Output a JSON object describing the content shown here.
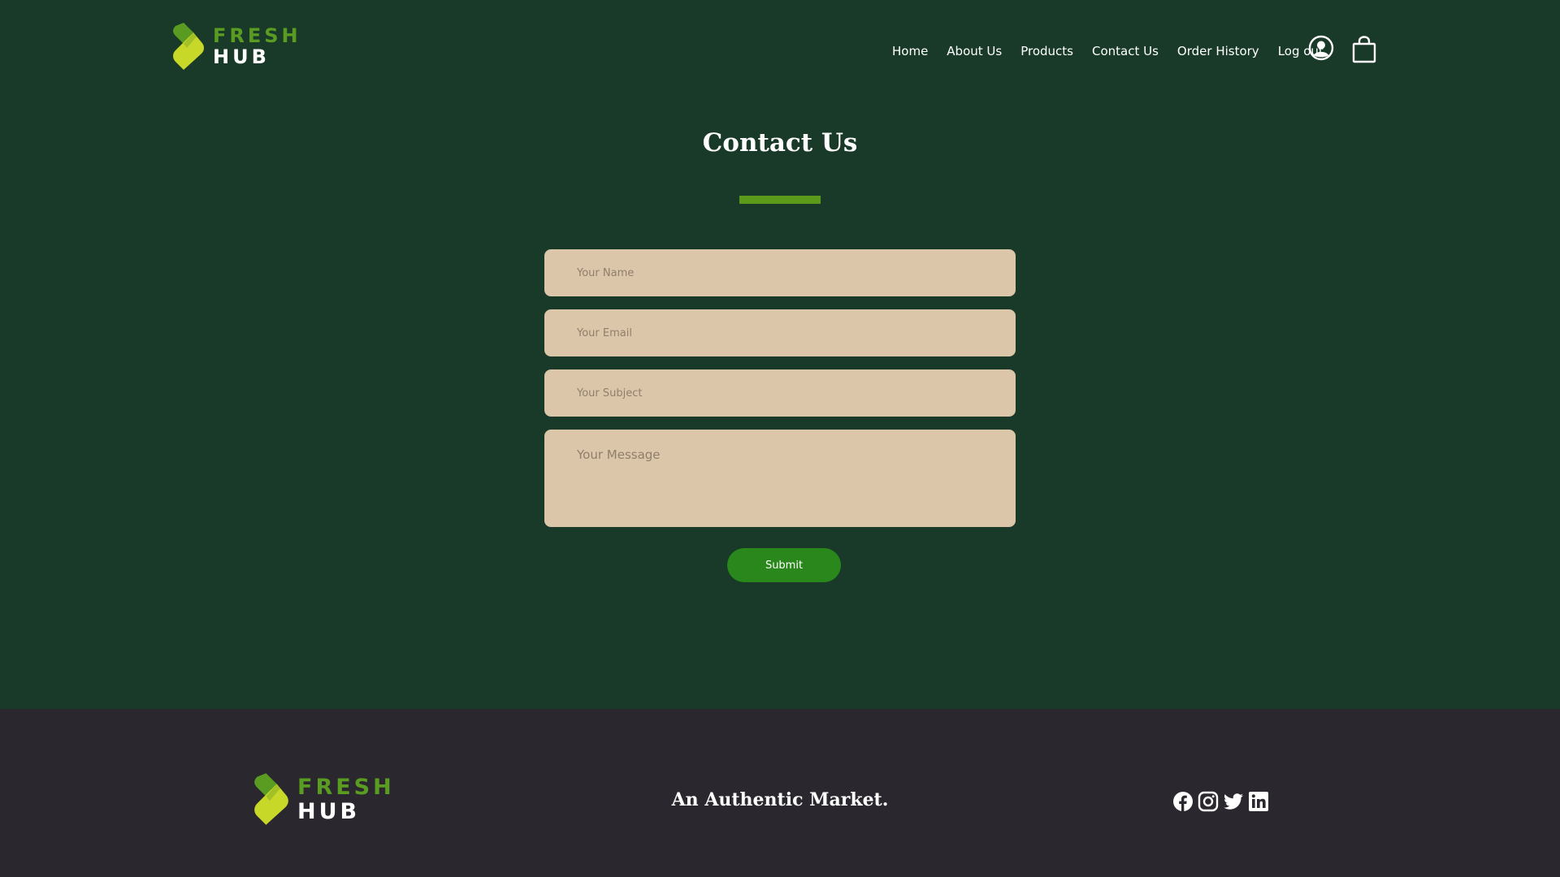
{
  "brand": {
    "line1": "FRESH",
    "line2": "HUB",
    "colors": {
      "green": "#5a9c22",
      "lime": "#c8d829",
      "dark_green": "#193a28"
    }
  },
  "nav": {
    "items": [
      "Home",
      "About Us",
      "Products",
      "Contact Us",
      "Order History",
      "Log out"
    ],
    "icons": [
      "user-circle-icon",
      "shopping-bag-icon"
    ]
  },
  "main": {
    "title": "Contact Us",
    "form": {
      "name_placeholder": "Your Name",
      "email_placeholder": "Your Email",
      "subject_placeholder": "Your Subject",
      "message_placeholder": "Your Message",
      "submit_label": "Submit"
    }
  },
  "footer": {
    "tagline": "An Authentic Market.",
    "social_icons": [
      "facebook-icon",
      "instagram-icon",
      "twitter-icon",
      "linkedin-icon"
    ],
    "background": "#2b272e"
  }
}
